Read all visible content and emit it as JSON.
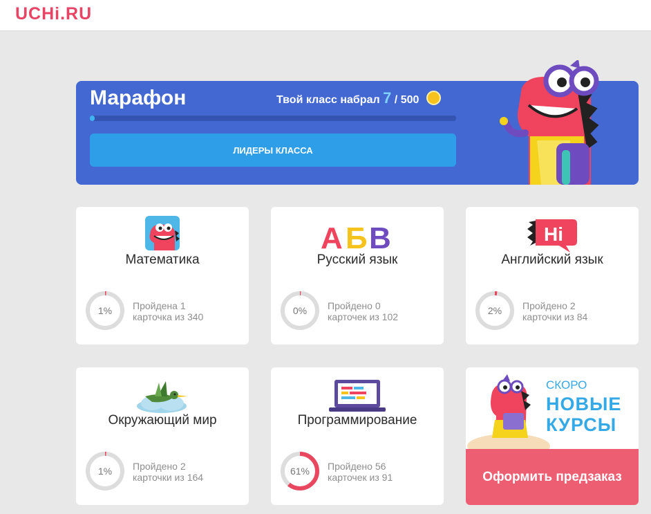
{
  "header": {
    "logo": "UCHi.RU"
  },
  "marathon": {
    "title": "Марафон",
    "score_prefix": "Твой класс набрал",
    "score_current": "7",
    "score_sep": " / ",
    "score_total": "500",
    "progress": 0.014,
    "leaders_label": "ЛИДЕРЫ КЛАССА"
  },
  "courses": [
    {
      "title": "Математика",
      "percent_label": "1%",
      "percent": 0.01,
      "line1": "Пройдена 1",
      "line2": "карточка из 340"
    },
    {
      "title": "Русский язык",
      "percent_label": "0%",
      "percent": 0.0,
      "line1": "Пройдено 0",
      "line2": "карточек из 102"
    },
    {
      "title": "Английский язык",
      "percent_label": "2%",
      "percent": 0.02,
      "line1": "Пройдено 2",
      "line2": "карточки из 84"
    },
    {
      "title": "Окружающий мир",
      "percent_label": "1%",
      "percent": 0.01,
      "line1": "Пройдено 2",
      "line2": "карточки из 164"
    },
    {
      "title": "Программирование",
      "percent_label": "61%",
      "percent": 0.61,
      "line1": "Пройдено 56",
      "line2": "карточек из 91"
    }
  ],
  "russian_icon_letters": [
    "А",
    "Б",
    "В"
  ],
  "english_icon_text": "Hi",
  "promo": {
    "soon": "СКОРО",
    "new_courses": "НОВЫЕ КУРСЫ",
    "button_label": "Оформить предзаказ"
  },
  "colors": {
    "brand": "#e84466",
    "banner": "#4368d2",
    "button_blue": "#2f9ee9",
    "ring_track": "#dddddd",
    "ring_progress": "#e8475f",
    "promo_button": "#ed5e72"
  }
}
